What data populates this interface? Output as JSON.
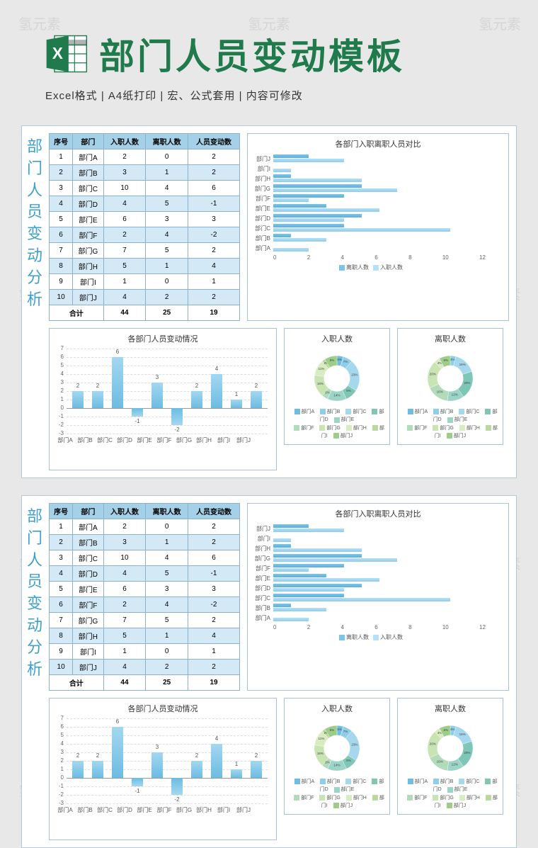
{
  "header": {
    "title": "部门人员变动模板",
    "subtitle": "Excel格式 |  A4纸打印  |  宏、公式套用  |  内容可修改"
  },
  "watermark": "氢元素",
  "panel": {
    "side_label": "部门人员变动分析"
  },
  "table": {
    "headers": [
      "序号",
      "部门",
      "入职人数",
      "离职人数",
      "人员变动数"
    ],
    "rows": [
      {
        "n": "1",
        "dept": "部门A",
        "in": "2",
        "out": "0",
        "chg": "2"
      },
      {
        "n": "2",
        "dept": "部门B",
        "in": "3",
        "out": "1",
        "chg": "2"
      },
      {
        "n": "3",
        "dept": "部门C",
        "in": "10",
        "out": "4",
        "chg": "6"
      },
      {
        "n": "4",
        "dept": "部门D",
        "in": "4",
        "out": "5",
        "chg": "-1"
      },
      {
        "n": "5",
        "dept": "部门E",
        "in": "6",
        "out": "3",
        "chg": "3"
      },
      {
        "n": "6",
        "dept": "部门F",
        "in": "2",
        "out": "4",
        "chg": "-2"
      },
      {
        "n": "7",
        "dept": "部门G",
        "in": "7",
        "out": "5",
        "chg": "2"
      },
      {
        "n": "8",
        "dept": "部门H",
        "in": "5",
        "out": "1",
        "chg": "4"
      },
      {
        "n": "9",
        "dept": "部门I",
        "in": "1",
        "out": "0",
        "chg": "1"
      },
      {
        "n": "10",
        "dept": "部门J",
        "in": "4",
        "out": "2",
        "chg": "2"
      }
    ],
    "footer": {
      "label": "合计",
      "in": "44",
      "out": "25",
      "chg": "19"
    }
  },
  "chart_data": [
    {
      "type": "bar",
      "orientation": "horizontal",
      "title": "各部门入职离职人员对比",
      "categories": [
        "部门J",
        "部门I",
        "部门H",
        "部门G",
        "部门F",
        "部门E",
        "部门D",
        "部门C",
        "部门B",
        "部门A"
      ],
      "series": [
        {
          "name": "离职人数",
          "values": [
            2,
            0,
            1,
            5,
            4,
            3,
            5,
            4,
            1,
            0
          ]
        },
        {
          "name": "入职人数",
          "values": [
            4,
            1,
            5,
            7,
            2,
            6,
            4,
            10,
            3,
            2
          ]
        }
      ],
      "xlim": [
        0,
        12
      ],
      "xticks": [
        0,
        2,
        4,
        6,
        8,
        10,
        12
      ]
    },
    {
      "type": "bar",
      "title": "各部门人员变动情况",
      "categories": [
        "部门A",
        "部门B",
        "部门C",
        "部门D",
        "部门E",
        "部门F",
        "部门G",
        "部门H",
        "部门I",
        "部门J"
      ],
      "values": [
        2,
        2,
        6,
        -1,
        3,
        -2,
        2,
        4,
        1,
        2
      ],
      "ylim": [
        -3,
        7
      ],
      "yticks": [
        -3,
        -2,
        -1,
        0,
        1,
        2,
        3,
        4,
        5,
        6,
        7
      ]
    },
    {
      "type": "pie",
      "subtype": "donut",
      "title": "入职人数",
      "labels": [
        "部门A",
        "部门B",
        "部门C",
        "部门D",
        "部门E",
        "部门F",
        "部门G",
        "部门H",
        "部门I",
        "部门J"
      ],
      "values": [
        2,
        3,
        10,
        4,
        6,
        2,
        7,
        5,
        1,
        4
      ],
      "percent": [
        "5%",
        "7%",
        "23%",
        "9%",
        "14%",
        "5%",
        "16%",
        "11%",
        "2%",
        "9%"
      ]
    },
    {
      "type": "pie",
      "subtype": "donut",
      "title": "离职人数",
      "labels": [
        "部门A",
        "部门B",
        "部门C",
        "部门D",
        "部门E",
        "部门F",
        "部门G",
        "部门H",
        "部门I",
        "部门J"
      ],
      "values": [
        0,
        1,
        4,
        5,
        3,
        4,
        5,
        1,
        0,
        2
      ],
      "percent": [
        "0%",
        "4%",
        "16%",
        "20%",
        "12%",
        "16%",
        "20%",
        "4%",
        "0%",
        "8%"
      ]
    }
  ],
  "legend": {
    "depts": [
      "部门A",
      "部门B",
      "部门C",
      "部门D",
      "部门E",
      "部门F",
      "部门G",
      "部门H",
      "部门I",
      "部门J"
    ]
  }
}
